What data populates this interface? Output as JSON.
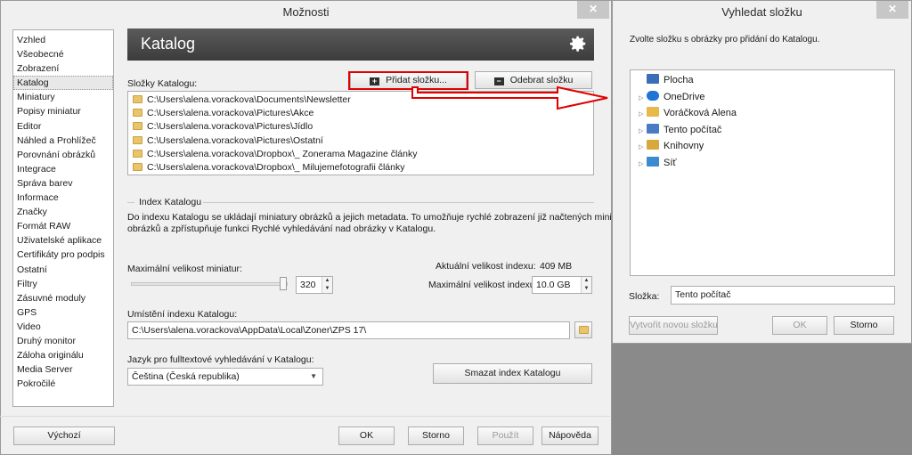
{
  "main_window": {
    "title": "Možnosti",
    "close_label": "✕",
    "nav": [
      "Vzhled",
      "Všeobecné",
      "Zobrazení",
      "Katalog",
      "Miniatury",
      "Popisy miniatur",
      "Editor",
      "Náhled a Prohlížeč",
      "Porovnání obrázků",
      "Integrace",
      "Správa barev",
      "Informace",
      "Značky",
      "Formát RAW",
      "Uživatelské aplikace",
      "Certifikáty pro podpis",
      "Ostatní",
      "Filtry",
      "Zásuvné moduly",
      "GPS",
      "Video",
      "Druhý monitor",
      "Záloha originálu",
      "Media Server",
      "Pokročilé"
    ],
    "selected_nav": "Katalog",
    "header_title": "Katalog",
    "folders_label": "Složky Katalogu:",
    "add_folder_button": "Přidat složku...",
    "remove_folder_button": "Odebrat složku",
    "folders": [
      "C:\\Users\\alena.vorackova\\Documents\\Newsletter",
      "C:\\Users\\alena.vorackova\\Pictures\\Akce",
      "C:\\Users\\alena.vorackova\\Pictures\\Jídlo",
      "C:\\Users\\alena.vorackova\\Pictures\\Ostatní",
      "C:\\Users\\alena.vorackova\\Dropbox\\_ Zonerama Magazine články",
      "C:\\Users\\alena.vorackova\\Dropbox\\_ Milujemefotografii články"
    ],
    "index_group_label": "Index Katalogu",
    "index_description_1": "Do indexu Katalogu se ukládají miniatury obrázků a jejich metadata. To umožňuje rychlé zobrazení již načtených miniatur",
    "index_description_2": "obrázků a zpřístupňuje funkci Rychlé vyhledávání nad obrázky v Katalogu.",
    "max_thumb_label": "Maximální velikost miniatur:",
    "max_thumb_value": "320",
    "slider_fraction": 0.97,
    "current_index_label": "Aktuální velikost indexu:",
    "current_index_value": "409 MB",
    "max_index_label": "Maximální velikost indexu:",
    "max_index_value": "10.0 GB",
    "index_location_label": "Umístění indexu Katalogu:",
    "index_location_value": "C:\\Users\\alena.vorackova\\AppData\\Local\\Zoner\\ZPS 17\\",
    "language_label": "Jazyk pro fulltextové vyhledávání v Katalogu:",
    "language_value": "Čeština (Česká republika)",
    "clear_index_button": "Smazat index Katalogu",
    "default_button": "Výchozí",
    "ok_button": "OK",
    "cancel_button": "Storno",
    "apply_button": "Použít",
    "help_button": "Nápověda"
  },
  "browse_window": {
    "title": "Vyhledat složku",
    "close_label": "✕",
    "instruction": "Zvolte složku s obrázky pro přidání do Katalogu.",
    "tree": [
      {
        "label": "Plocha",
        "icon": "desktop-icon",
        "expandable": false
      },
      {
        "label": "OneDrive",
        "icon": "cloud-icon",
        "expandable": true
      },
      {
        "label": "Voráčková Alena",
        "icon": "user-folder-icon",
        "expandable": true
      },
      {
        "label": "Tento počítač",
        "icon": "computer-icon",
        "expandable": true
      },
      {
        "label": "Knihovny",
        "icon": "library-icon",
        "expandable": true
      },
      {
        "label": "Síť",
        "icon": "network-icon",
        "expandable": true
      }
    ],
    "folder_label": "Složka:",
    "folder_value": "Tento počítač",
    "new_folder_button": "Vytvořit novou složku",
    "ok_button": "OK",
    "cancel_button": "Storno"
  },
  "colors": {
    "callout": "#e00000",
    "header_bar": "#474747"
  }
}
